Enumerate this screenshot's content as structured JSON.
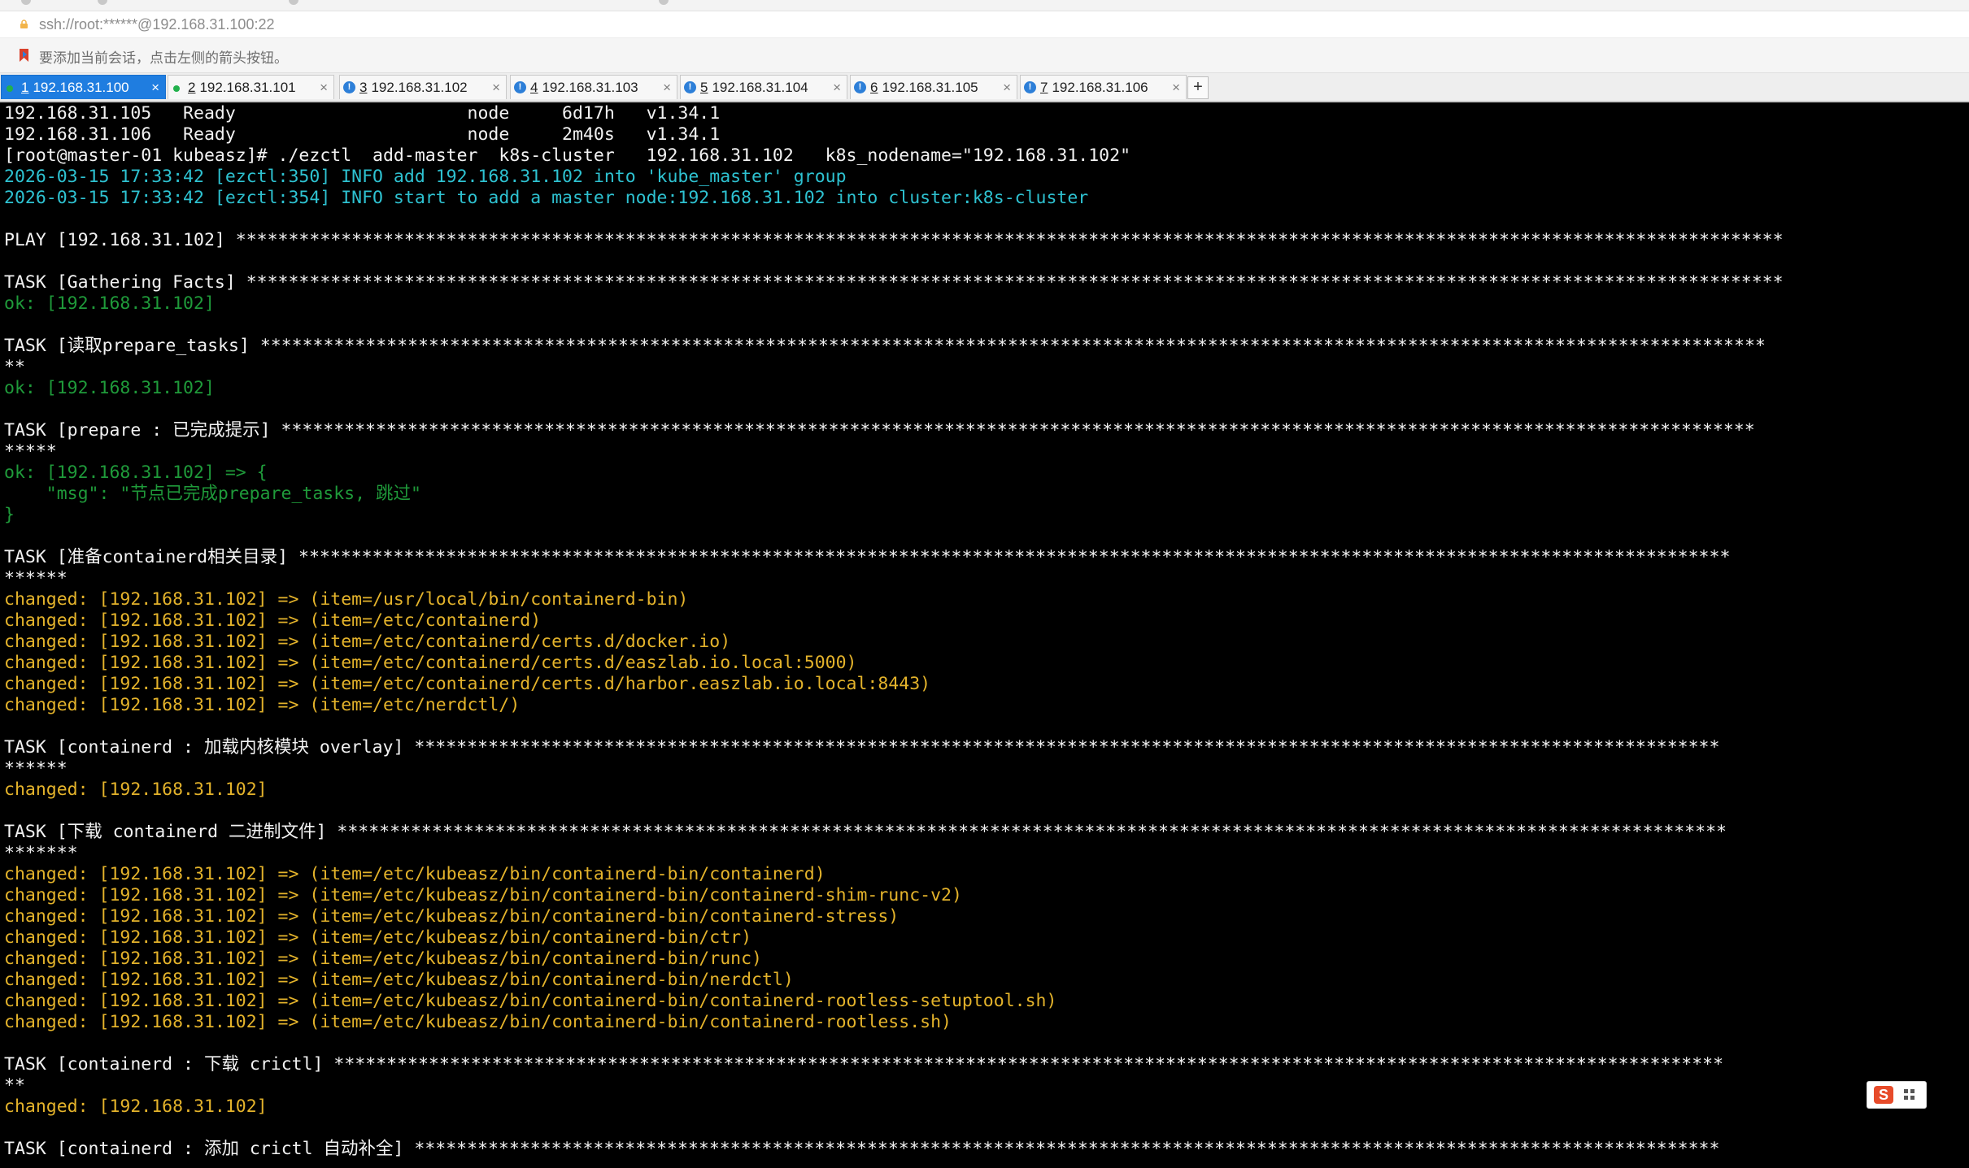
{
  "address": {
    "text": "ssh://root:******@192.168.31.100:22"
  },
  "hint": {
    "text": "要添加当前会话，点击左侧的箭头按钮。"
  },
  "tabs": [
    {
      "num": "1",
      "host": "192.168.31.100",
      "state": "ok",
      "active": true
    },
    {
      "num": "2",
      "host": "192.168.31.101",
      "state": "ok",
      "active": false
    },
    {
      "num": "3",
      "host": "192.168.31.102",
      "state": "info",
      "active": false
    },
    {
      "num": "4",
      "host": "192.168.31.103",
      "state": "info",
      "active": false
    },
    {
      "num": "5",
      "host": "192.168.31.104",
      "state": "info",
      "active": false
    },
    {
      "num": "6",
      "host": "192.168.31.105",
      "state": "info",
      "active": false
    },
    {
      "num": "7",
      "host": "192.168.31.106",
      "state": "info",
      "active": false
    }
  ],
  "tab_close_glyph": "×",
  "tab_add_glyph": "+",
  "colors": {
    "terminal_bg": "#000000",
    "white": "#f2f2f2",
    "cyan": "#2ec2d1",
    "green": "#1f9a3a",
    "yellow": "#e4b32b",
    "active_tab": "#1f7de0"
  },
  "terminal": {
    "lines": [
      {
        "text": "192.168.31.105   Ready                      node     6d17h   v1.34.1",
        "color": "white"
      },
      {
        "text": "192.168.31.106   Ready                      node     2m40s   v1.34.1",
        "color": "white"
      },
      {
        "text": "[root@master-01 kubeasz]# ./ezctl  add-master  k8s-cluster   192.168.31.102   k8s_nodename=\"192.168.31.102\"",
        "color": "white"
      },
      {
        "text": "2026-03-15 17:33:42 [ezctl:350] INFO add 192.168.31.102 into 'kube_master' group",
        "color": "cyan"
      },
      {
        "text": "2026-03-15 17:33:42 [ezctl:354] INFO start to add a master node:192.168.31.102 into cluster:k8s-cluster",
        "color": "cyan"
      },
      {
        "text": "",
        "color": "white"
      },
      {
        "text": "PLAY [192.168.31.102] ***************************************************************************************************************************************************",
        "color": "white"
      },
      {
        "text": "",
        "color": "white"
      },
      {
        "text": "TASK [Gathering Facts] **************************************************************************************************************************************************",
        "color": "white"
      },
      {
        "text": "ok: [192.168.31.102]",
        "color": "green"
      },
      {
        "text": "",
        "color": "white"
      },
      {
        "text": "TASK [读取prepare_tasks] ***********************************************************************************************************************************************",
        "color": "white"
      },
      {
        "text": "**",
        "color": "white"
      },
      {
        "text": "ok: [192.168.31.102]",
        "color": "green"
      },
      {
        "text": "",
        "color": "white"
      },
      {
        "text": "TASK [prepare : 已完成提示] ********************************************************************************************************************************************",
        "color": "white"
      },
      {
        "text": "*****",
        "color": "white"
      },
      {
        "text": "ok: [192.168.31.102] => {",
        "color": "green"
      },
      {
        "text": "    \"msg\": \"节点已完成prepare_tasks, 跳过\"",
        "color": "green"
      },
      {
        "text": "}",
        "color": "green"
      },
      {
        "text": "",
        "color": "white"
      },
      {
        "text": "TASK [准备containerd相关目录] ****************************************************************************************************************************************",
        "color": "white"
      },
      {
        "text": "******",
        "color": "white"
      },
      {
        "text": "changed: [192.168.31.102] => (item=/usr/local/bin/containerd-bin)",
        "color": "yellow"
      },
      {
        "text": "changed: [192.168.31.102] => (item=/etc/containerd)",
        "color": "yellow"
      },
      {
        "text": "changed: [192.168.31.102] => (item=/etc/containerd/certs.d/docker.io)",
        "color": "yellow"
      },
      {
        "text": "changed: [192.168.31.102] => (item=/etc/containerd/certs.d/easzlab.io.local:5000)",
        "color": "yellow"
      },
      {
        "text": "changed: [192.168.31.102] => (item=/etc/containerd/certs.d/harbor.easzlab.io.local:8443)",
        "color": "yellow"
      },
      {
        "text": "changed: [192.168.31.102] => (item=/etc/nerdctl/)",
        "color": "yellow"
      },
      {
        "text": "",
        "color": "white"
      },
      {
        "text": "TASK [containerd : 加载内核模块 overlay] ****************************************************************************************************************************",
        "color": "white"
      },
      {
        "text": "******",
        "color": "white"
      },
      {
        "text": "changed: [192.168.31.102]",
        "color": "yellow"
      },
      {
        "text": "",
        "color": "white"
      },
      {
        "text": "TASK [下载 containerd 二进制文件] ************************************************************************************************************************************",
        "color": "white"
      },
      {
        "text": "*******",
        "color": "white"
      },
      {
        "text": "changed: [192.168.31.102] => (item=/etc/kubeasz/bin/containerd-bin/containerd)",
        "color": "yellow"
      },
      {
        "text": "changed: [192.168.31.102] => (item=/etc/kubeasz/bin/containerd-bin/containerd-shim-runc-v2)",
        "color": "yellow"
      },
      {
        "text": "changed: [192.168.31.102] => (item=/etc/kubeasz/bin/containerd-bin/containerd-stress)",
        "color": "yellow"
      },
      {
        "text": "changed: [192.168.31.102] => (item=/etc/kubeasz/bin/containerd-bin/ctr)",
        "color": "yellow"
      },
      {
        "text": "changed: [192.168.31.102] => (item=/etc/kubeasz/bin/containerd-bin/runc)",
        "color": "yellow"
      },
      {
        "text": "changed: [192.168.31.102] => (item=/etc/kubeasz/bin/containerd-bin/nerdctl)",
        "color": "yellow"
      },
      {
        "text": "changed: [192.168.31.102] => (item=/etc/kubeasz/bin/containerd-bin/containerd-rootless-setuptool.sh)",
        "color": "yellow"
      },
      {
        "text": "changed: [192.168.31.102] => (item=/etc/kubeasz/bin/containerd-bin/containerd-rootless.sh)",
        "color": "yellow"
      },
      {
        "text": "",
        "color": "white"
      },
      {
        "text": "TASK [containerd : 下载 crictl] ************************************************************************************************************************************",
        "color": "white"
      },
      {
        "text": "**",
        "color": "white"
      },
      {
        "text": "changed: [192.168.31.102]",
        "color": "yellow"
      },
      {
        "text": "",
        "color": "white"
      },
      {
        "text": "TASK [containerd : 添加 crictl 自动补全] ****************************************************************************************************************************",
        "color": "white"
      }
    ]
  },
  "ime_widget": {
    "letter": "S"
  }
}
